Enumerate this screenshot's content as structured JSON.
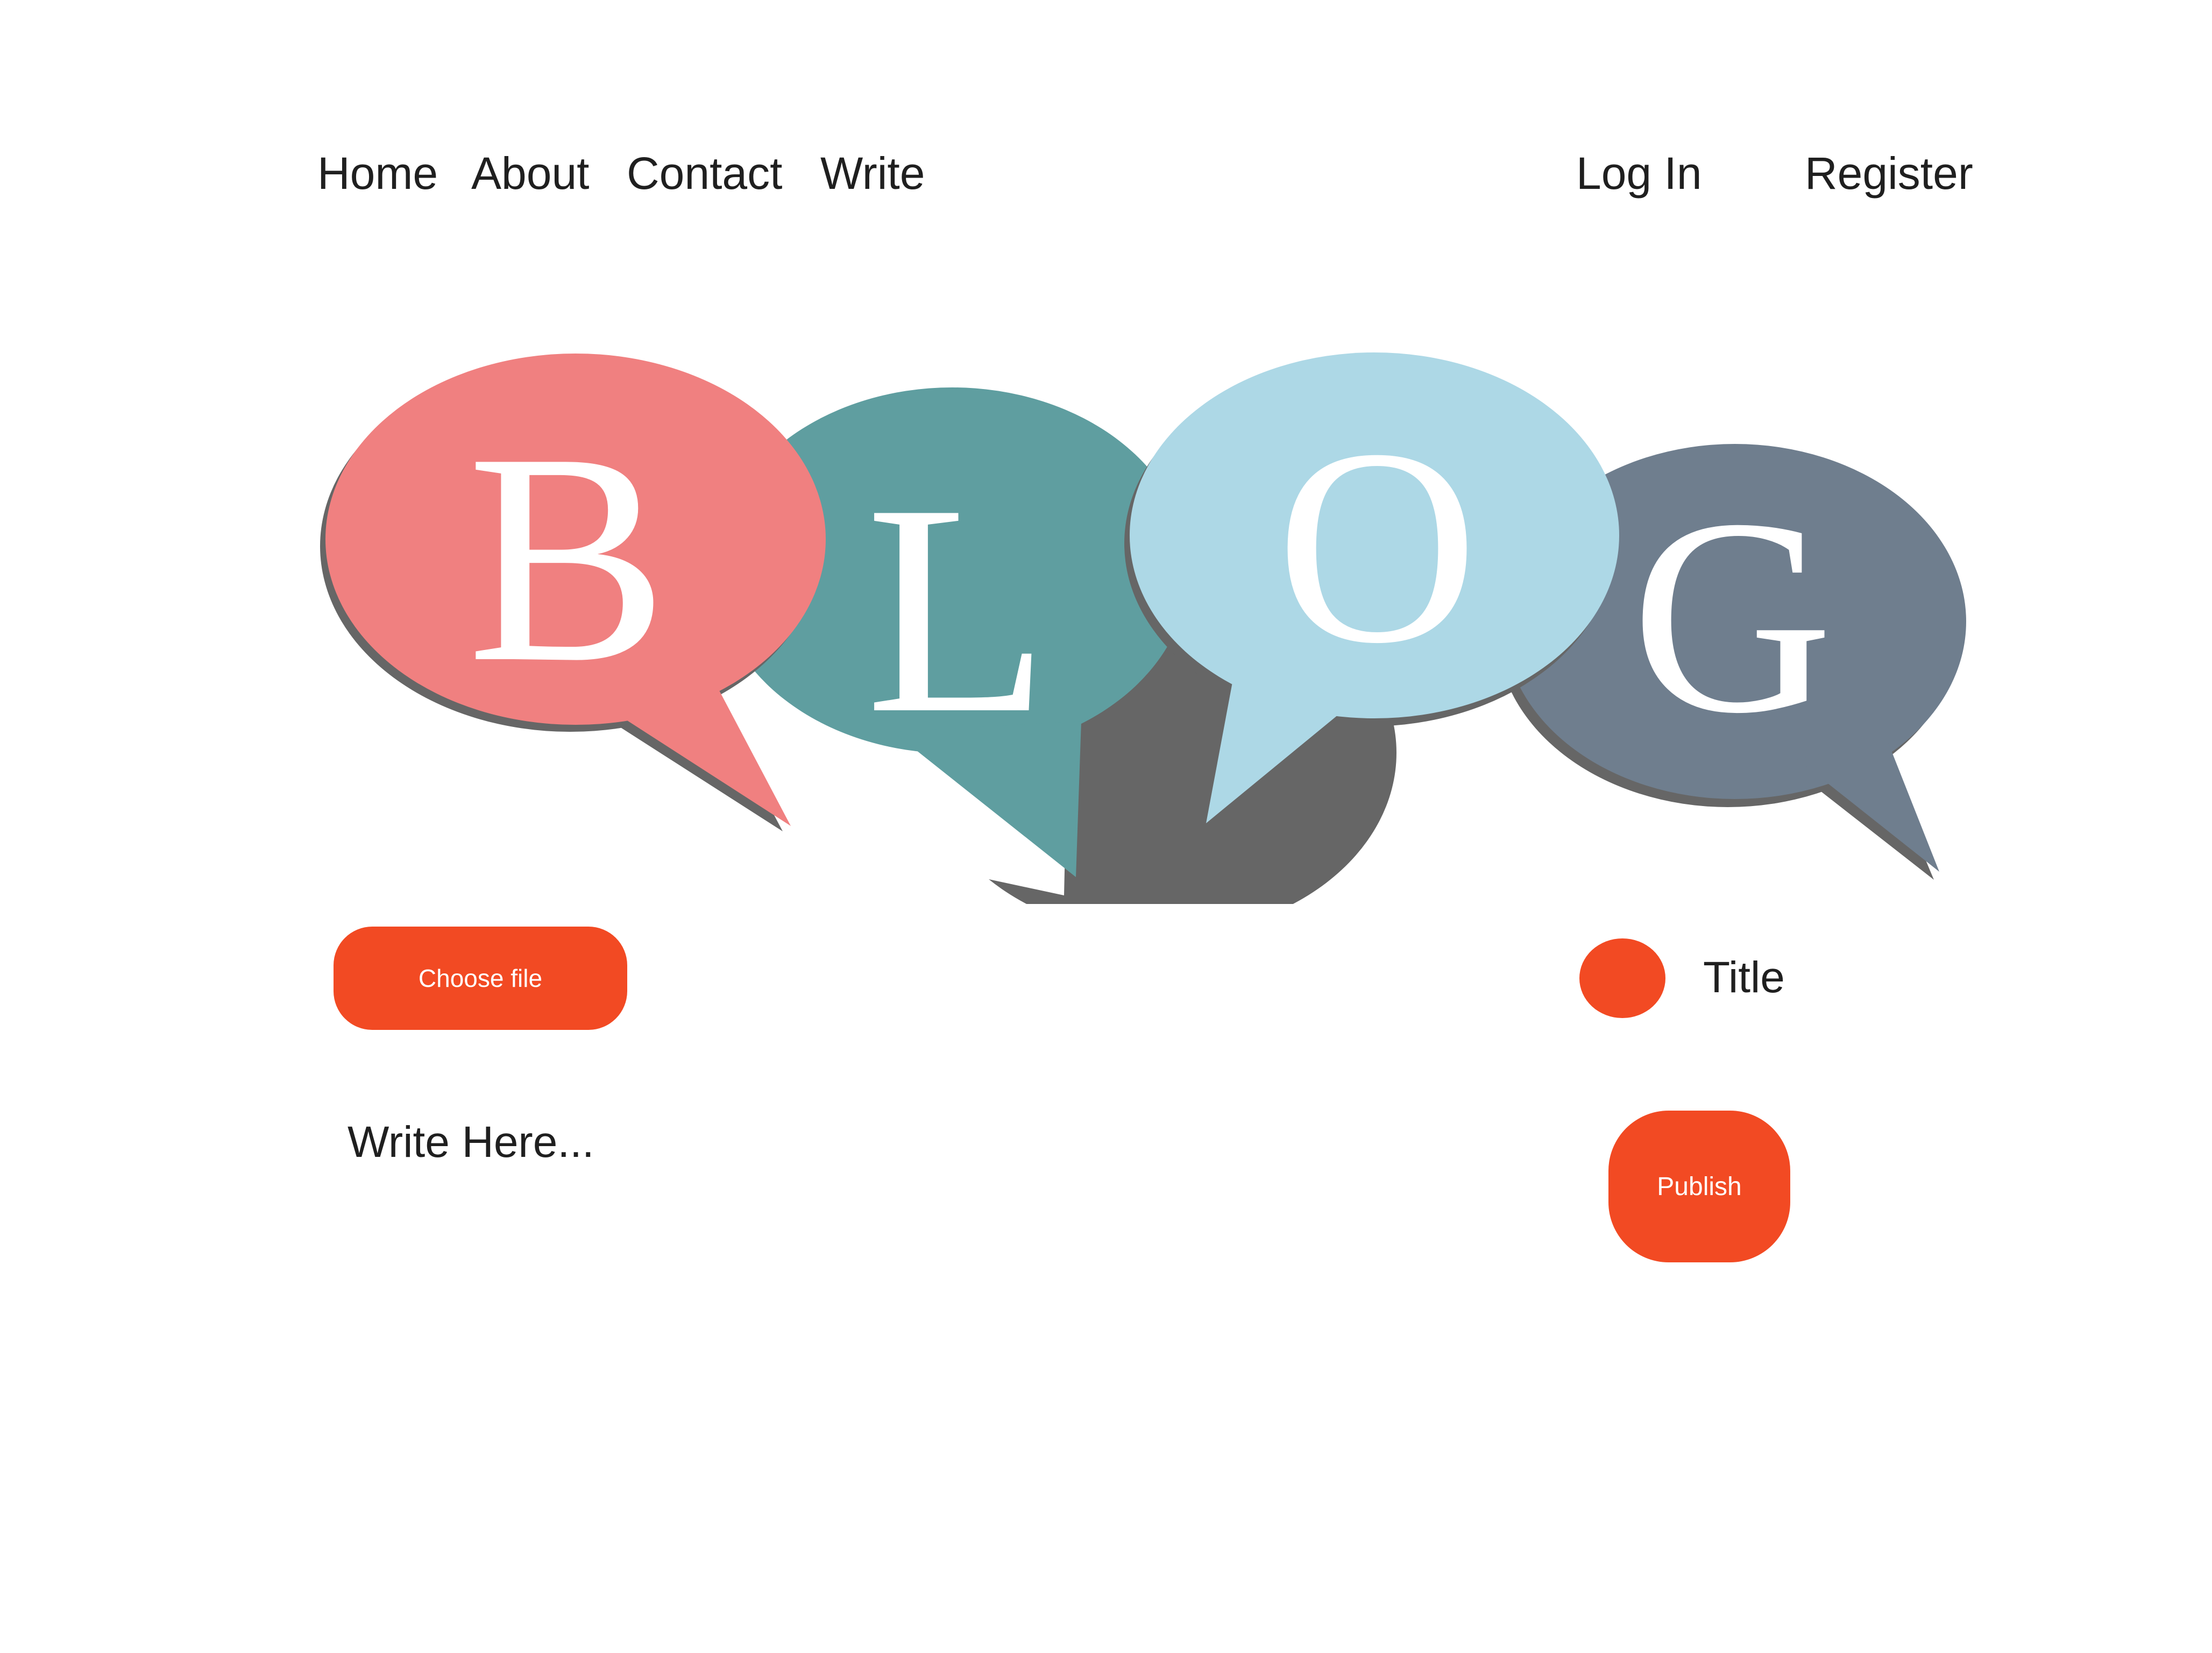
{
  "nav": {
    "home": "Home",
    "about": "About",
    "contact": "Contact",
    "write": "Write",
    "login": "Log In",
    "register": "Register"
  },
  "hero": {
    "letters": [
      "B",
      "L",
      "O",
      "G"
    ],
    "bubble_colors": [
      "#f08080",
      "#5f9ea0",
      "#add8e6",
      "#6f7e8e"
    ],
    "shadow_color": "#666666"
  },
  "editor": {
    "choose_file_label": "Choose file",
    "title_label": "Title",
    "body_placeholder": "Write Here...",
    "publish_label": "Publish"
  },
  "colors": {
    "accent": "#f24a23",
    "text": "#1f1f1f",
    "background": "#ffffff"
  }
}
